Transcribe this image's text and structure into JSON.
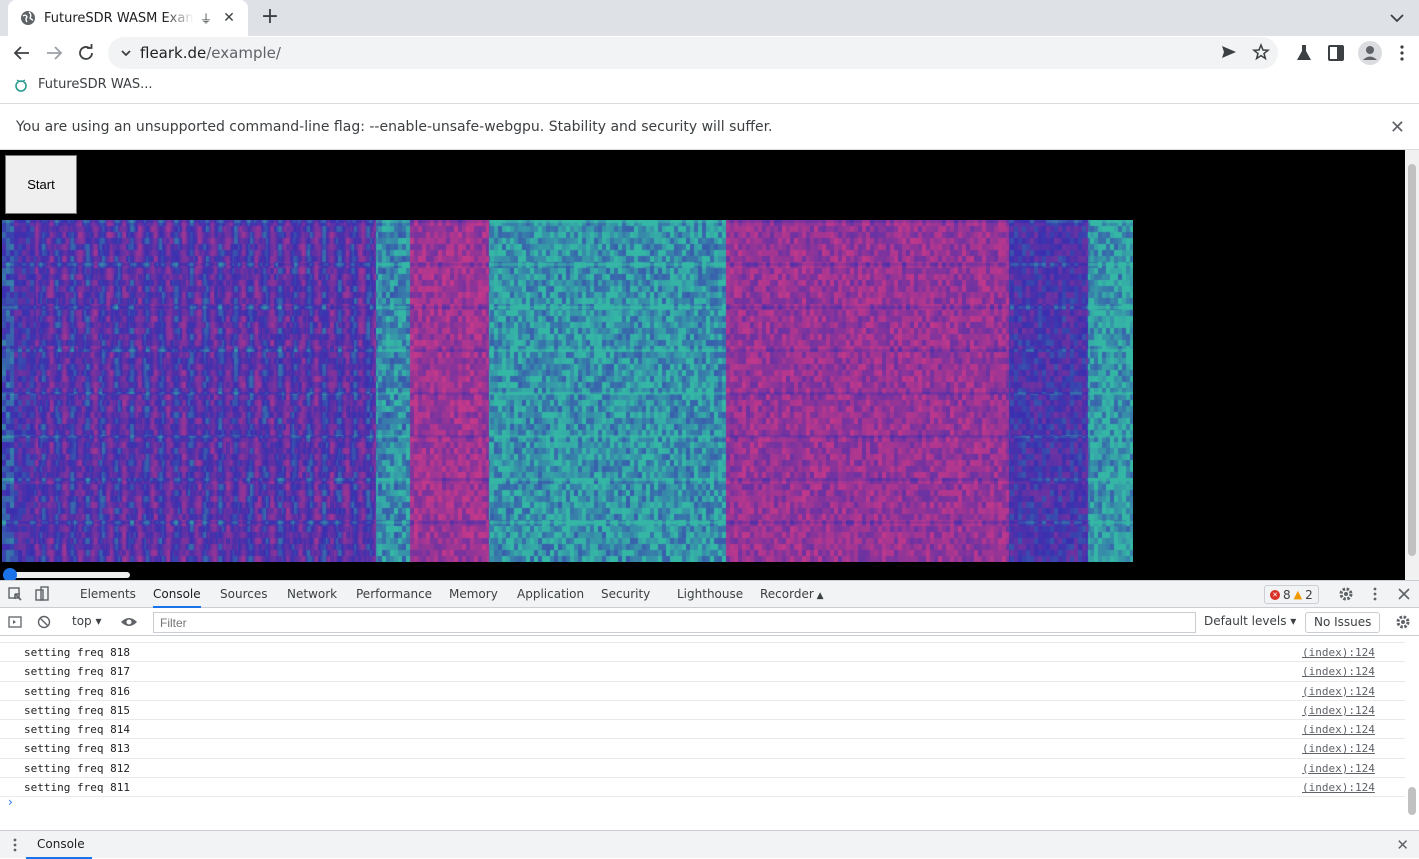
{
  "browser": {
    "tab_title": "FutureSDR WASM Example",
    "tab_close": "✕",
    "new_tab": "+",
    "url_host": "fleark.de",
    "url_path": "/example/",
    "bookmark_label": "FutureSDR WAS..."
  },
  "infobar": {
    "message": "You are using an unsupported command-line flag: --enable-unsafe-webgpu. Stability and security will suffer.",
    "close": "✕"
  },
  "page": {
    "start_label": "Start",
    "slider_value": 0
  },
  "devtools": {
    "tabs": [
      "Elements",
      "Console",
      "Sources",
      "Network",
      "Performance",
      "Memory",
      "Application",
      "Security",
      "Lighthouse",
      "Recorder"
    ],
    "active_tab": "Console",
    "error_count": "8",
    "warning_count": "2",
    "context": "top",
    "filter_placeholder": "Filter",
    "levels": "Default levels",
    "issues": "No Issues",
    "drawer_tab": "Console",
    "log_rows": [
      {
        "text": "setting freq 818",
        "src": "(index):124"
      },
      {
        "text": "setting freq 817",
        "src": "(index):124"
      },
      {
        "text": "setting freq 816",
        "src": "(index):124"
      },
      {
        "text": "setting freq 815",
        "src": "(index):124"
      },
      {
        "text": "setting freq 814",
        "src": "(index):124"
      },
      {
        "text": "setting freq 813",
        "src": "(index):124"
      },
      {
        "text": "setting freq 812",
        "src": "(index):124"
      },
      {
        "text": "setting freq 811",
        "src": "(index):124"
      }
    ],
    "prompt": "›"
  },
  "colors": {
    "accent": "#1a73e8",
    "waterfall_low": "#3a2fb0",
    "waterfall_mid": "#35b7a6",
    "waterfall_high": "#c2388a"
  }
}
